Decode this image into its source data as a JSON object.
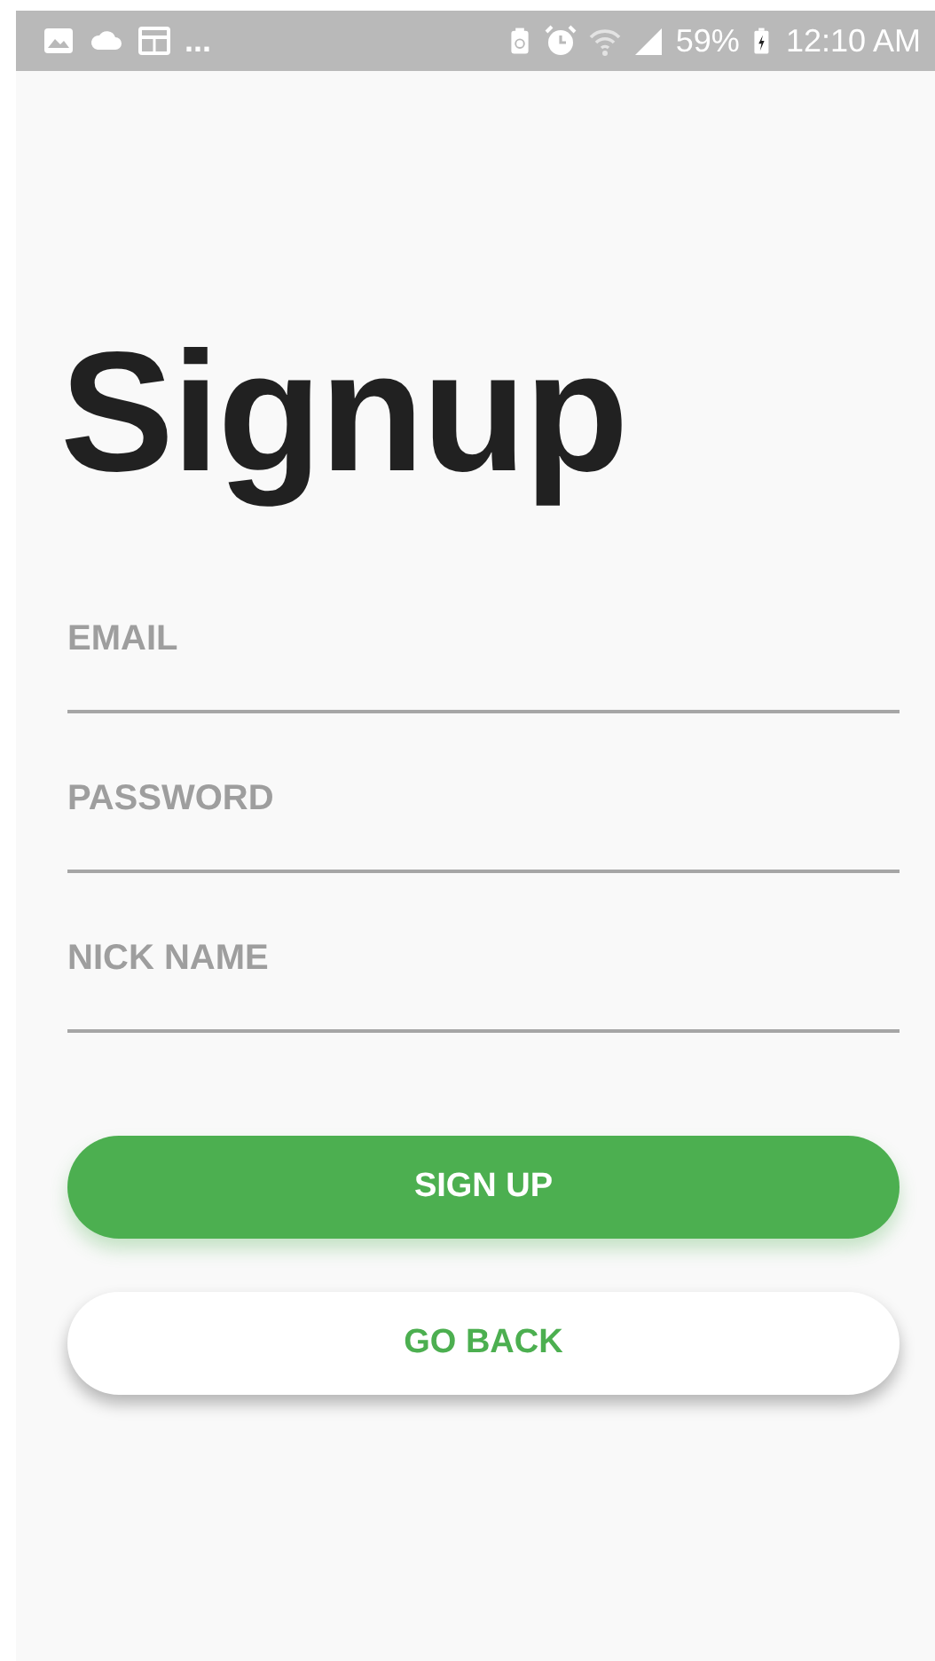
{
  "status_bar": {
    "overflow": "...",
    "battery_percent": "59%",
    "time": "12:10 AM"
  },
  "title": "Signup",
  "fields": [
    {
      "placeholder": "EMAIL"
    },
    {
      "placeholder": "PASSWORD"
    },
    {
      "placeholder": "NICK NAME"
    }
  ],
  "buttons": [
    {
      "label": "SIGN UP",
      "kind": "primary"
    },
    {
      "label": "GO BACK",
      "kind": "secondary"
    }
  ]
}
